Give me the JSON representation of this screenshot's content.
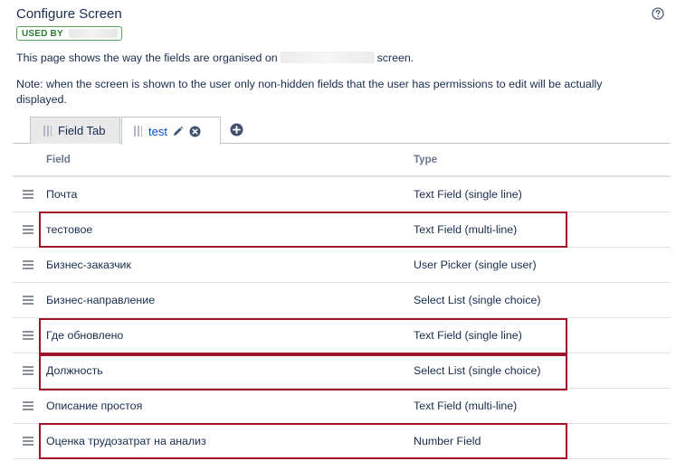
{
  "header": {
    "title": "Configure Screen",
    "used_by_label": "USED BY"
  },
  "description": {
    "before": "This page shows the way the fields are organised on",
    "after": "screen."
  },
  "note": "Note: when the screen is shown to the user only non-hidden fields that the user has permissions to edit will be actually displayed.",
  "tabs": [
    {
      "label": "Field Tab",
      "active": false
    },
    {
      "label": "test",
      "active": true
    }
  ],
  "table": {
    "columns": [
      "Field",
      "Type"
    ],
    "rows": [
      {
        "field": "Почта",
        "type": "Text Field (single line)",
        "highlighted": false
      },
      {
        "field": "тестовое",
        "type": "Text Field (multi-line)",
        "highlighted": true
      },
      {
        "field": "Бизнес-заказчик",
        "type": "User Picker (single user)",
        "highlighted": false
      },
      {
        "field": "Бизнес-направление",
        "type": "Select List (single choice)",
        "highlighted": false
      },
      {
        "field": "Где обновлено",
        "type": "Text Field (single line)",
        "highlighted": true
      },
      {
        "field": "Должность",
        "type": "Select List (single choice)",
        "highlighted": true
      },
      {
        "field": "Описание простоя",
        "type": "Text Field (multi-line)",
        "highlighted": false
      },
      {
        "field": "Оценка трудозатрат на анализ",
        "type": "Number Field",
        "highlighted": true
      }
    ]
  },
  "colors": {
    "link": "#0052cc",
    "highlight_border": "#a0142a",
    "used_by_green": "#2e7d32"
  },
  "icons": {
    "help": "question-circle-icon",
    "edit_tab": "pencil-icon",
    "remove_tab": "close-circle-icon",
    "add_tab": "plus-circle-icon",
    "row_drag": "drag-handle-icon",
    "tab_drag": "grip-icon"
  }
}
